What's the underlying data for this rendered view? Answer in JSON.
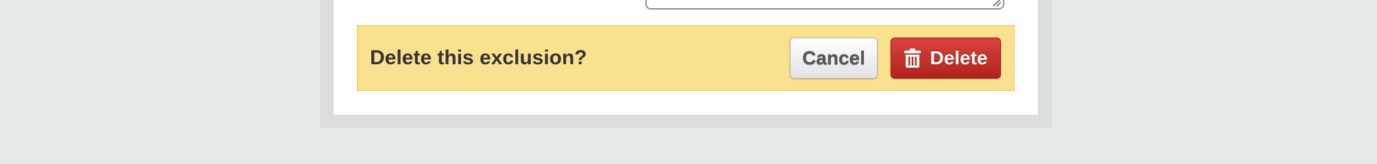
{
  "confirm": {
    "question": "Delete this exclusion?",
    "cancel_label": "Cancel",
    "delete_label": "Delete"
  },
  "icons": {
    "delete": "trash-icon",
    "resize": "resize-grip-icon"
  },
  "colors": {
    "page_background": "#e6ebea",
    "confirm_background": "#fae190",
    "confirm_border": "#f0c43a",
    "delete_button": "#c0312a",
    "cancel_button": "#f2f2f2"
  }
}
